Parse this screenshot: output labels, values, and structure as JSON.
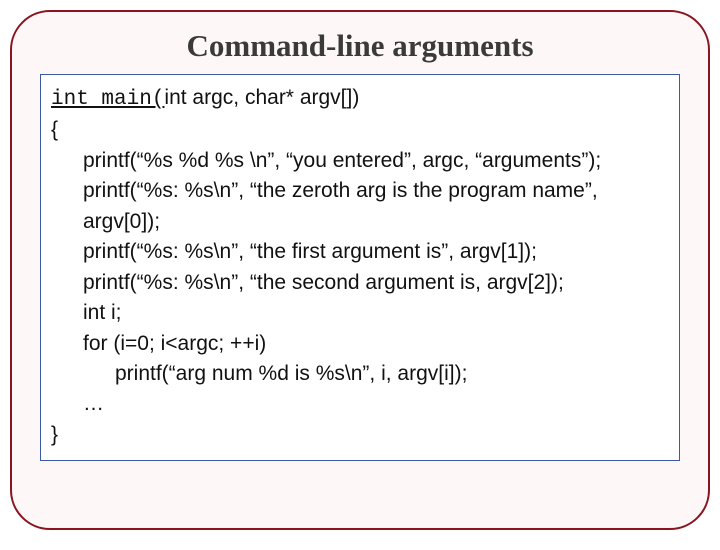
{
  "title": "Command-line arguments",
  "code": {
    "sig_kw": "int main(",
    "sig_rest": "int argc, char* argv[])",
    "open_brace": "{",
    "l1": "printf(“%s %d %s \\n”, “you entered”, argc, “arguments”);",
    "l2": "printf(“%s: %s\\n”, “the zeroth arg is the program name”,",
    "l3": "argv[0]);",
    "l4": "printf(“%s: %s\\n”, “the first argument is”, argv[1]);",
    "l5": "printf(“%s: %s\\n”, “the second argument is, argv[2]);",
    "l6": "int  i;",
    "l7": "for (i=0; i<argc; ++i)",
    "l8": "printf(“arg num %d is %s\\n”, i, argv[i]);",
    "l9": "…",
    "close_brace": "}"
  }
}
